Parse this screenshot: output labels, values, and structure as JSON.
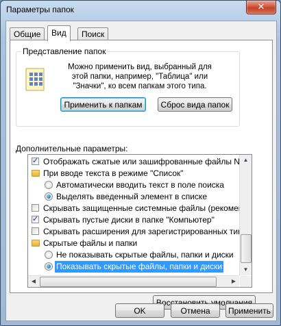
{
  "window": {
    "title": "Параметры папок",
    "close_label": "✕"
  },
  "tabs": [
    {
      "label": "Общие",
      "active": false
    },
    {
      "label": "Вид",
      "active": true
    },
    {
      "label": "Поиск",
      "active": false
    }
  ],
  "folder_view": {
    "group_label": "Представление папок",
    "description": "Можно применить вид, выбранный для этой папки, например, \"Таблица\" или \"Значки\", ко всем папкам этого типа.",
    "apply_button": "Применить к папкам",
    "reset_button": "Сброс вида папок"
  },
  "advanced": {
    "label": "Дополнительные параметры:",
    "items": [
      {
        "type": "checkbox",
        "checked": true,
        "indent": 0,
        "label": "Отображать сжатые или зашифрованные файлы NTI"
      },
      {
        "type": "folder",
        "indent": 0,
        "label": "При вводе текста в режиме \"Список\""
      },
      {
        "type": "radio",
        "checked": false,
        "indent": 1,
        "label": "Автоматически вводить текст в поле поиска"
      },
      {
        "type": "radio",
        "checked": true,
        "indent": 1,
        "label": "Выделять введенный элемент в списке"
      },
      {
        "type": "checkbox",
        "checked": false,
        "indent": 0,
        "label": "Скрывать защищенные системные файлы (рекомен,"
      },
      {
        "type": "checkbox",
        "checked": true,
        "indent": 0,
        "label": "Скрывать пустые диски в папке \"Компьютер\""
      },
      {
        "type": "checkbox",
        "checked": false,
        "indent": 0,
        "label": "Скрывать расширения для зарегистрированных типо"
      },
      {
        "type": "folder",
        "indent": 0,
        "label": "Скрытые файлы и папки"
      },
      {
        "type": "radio",
        "checked": false,
        "indent": 1,
        "label": "Не показывать скрытые файлы, папки и диски"
      },
      {
        "type": "radio",
        "checked": true,
        "indent": 1,
        "selected": true,
        "label": "Показывать скрытые файлы, папки и диски"
      }
    ],
    "restore_button": "Восстановить умолчания"
  },
  "footer": {
    "ok": "OK",
    "cancel": "Отмена",
    "apply": "Применить"
  }
}
